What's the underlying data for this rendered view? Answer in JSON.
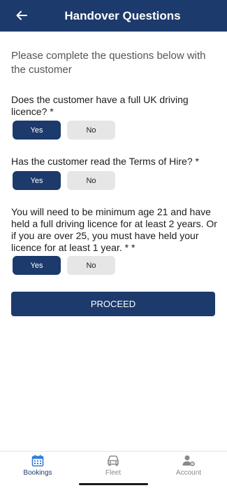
{
  "header": {
    "title": "Handover Questions"
  },
  "intro": "Please complete the questions below with the customer",
  "questions": [
    {
      "text": "Does the customer have a full UK driving licence? *",
      "yes": "Yes",
      "no": "No",
      "selected": "yes"
    },
    {
      "text": "Has the customer read the Terms of Hire? *",
      "yes": "Yes",
      "no": "No",
      "selected": "yes"
    },
    {
      "text": "You will need to be minimum age 21 and have held a full driving licence for at least 2 years. Or if you are over 25, you must have held your licence for at least 1 year. * *",
      "yes": "Yes",
      "no": "No",
      "selected": "yes"
    }
  ],
  "proceed_label": "PROCEED",
  "tabs": [
    {
      "label": "Bookings",
      "icon": "calendar-icon",
      "active": true
    },
    {
      "label": "Fleet",
      "icon": "car-icon",
      "active": false
    },
    {
      "label": "Account",
      "icon": "user-settings-icon",
      "active": false
    }
  ],
  "colors": {
    "primary": "#1c3a6b",
    "unselected": "#e6e6e6",
    "accent_icon": "#2f7ddb"
  }
}
